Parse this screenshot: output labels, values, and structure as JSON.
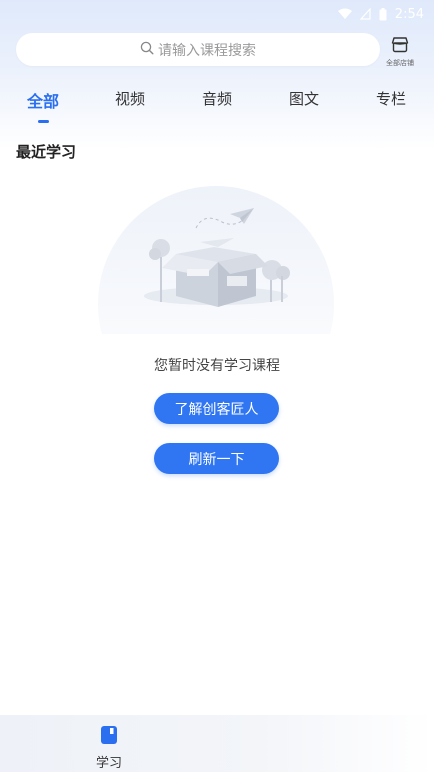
{
  "status_bar": {
    "time": "2:54"
  },
  "header": {
    "search": {
      "placeholder": "请输入课程搜索"
    },
    "store_button": {
      "label": "全部店铺"
    }
  },
  "tabs": [
    {
      "label": "全部",
      "active": true
    },
    {
      "label": "视频",
      "active": false
    },
    {
      "label": "音频",
      "active": false
    },
    {
      "label": "图文",
      "active": false
    },
    {
      "label": "专栏",
      "active": false
    }
  ],
  "section": {
    "title": "最近学习"
  },
  "empty_state": {
    "message": "您暂时没有学习课程",
    "primary_button": "了解创客匠人",
    "secondary_button": "刷新一下"
  },
  "bottom_nav": {
    "items": [
      {
        "label": "学习",
        "icon": "book-icon",
        "active": true
      }
    ]
  },
  "colors": {
    "accent": "#2a6ff0",
    "button": "#3076f2",
    "header_bg": "#dfe9fb"
  }
}
